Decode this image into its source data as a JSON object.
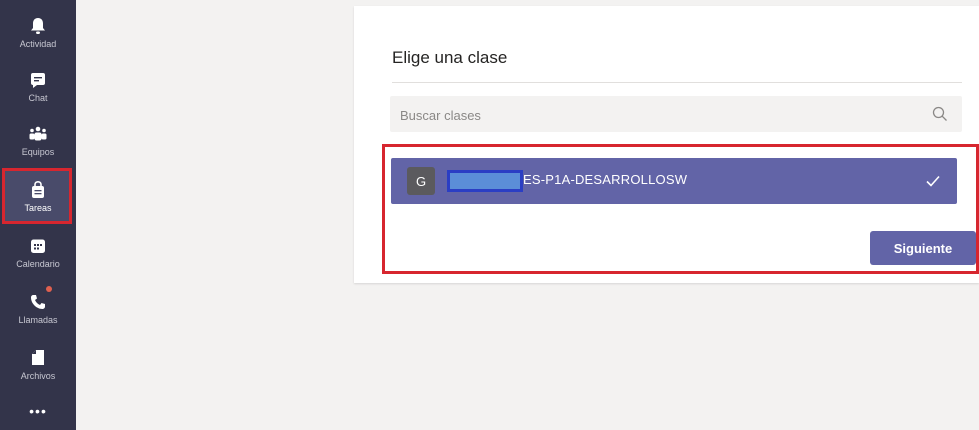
{
  "rail": {
    "items": [
      {
        "label": "Actividad",
        "icon": "bell-icon"
      },
      {
        "label": "Chat",
        "icon": "chat-icon"
      },
      {
        "label": "Equipos",
        "icon": "teams-icon"
      },
      {
        "label": "Tareas",
        "icon": "assignments-icon",
        "active": true
      },
      {
        "label": "Calendario",
        "icon": "calendar-icon"
      },
      {
        "label": "Llamadas",
        "icon": "phone-icon"
      },
      {
        "label": "Archivos",
        "icon": "file-icon"
      }
    ],
    "more": "•••"
  },
  "dialog": {
    "title": "Elige una clase",
    "search_placeholder": "Buscar clases",
    "selected_class": {
      "avatar_letter": "G",
      "name": "ES-P1A-DESARROLLOSW"
    },
    "next_label": "Siguiente"
  },
  "colors": {
    "rail_bg": "#33344a",
    "accent": "#6264a7",
    "highlight_red": "#d7262f",
    "notification": "#e0604f"
  }
}
